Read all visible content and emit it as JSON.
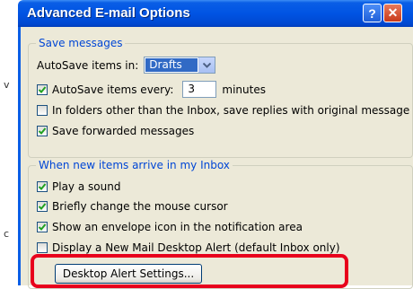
{
  "dialog": {
    "title": "Advanced E-mail Options",
    "help_glyph": "?",
    "close_glyph": "✕"
  },
  "left_edge": [
    "v",
    "c"
  ],
  "save_group": {
    "legend": "Save messages",
    "autosave_in_label": "AutoSave items in:",
    "autosave_in_value": "Drafts",
    "autosave_every": {
      "label": "AutoSave items every:",
      "value": "3",
      "unit": "minutes",
      "checked": true
    },
    "reply_other_folders": {
      "label": "In folders other than the Inbox, save replies with original message",
      "checked": false
    },
    "save_forwarded": {
      "label": "Save forwarded messages",
      "checked": true
    }
  },
  "arrive_group": {
    "legend": "When new items arrive in my Inbox",
    "play_sound": {
      "label": "Play a sound",
      "checked": true
    },
    "change_cursor": {
      "label": "Briefly change the mouse cursor",
      "checked": true
    },
    "envelope_icon": {
      "label": "Show an envelope icon in the notification area",
      "checked": true
    },
    "desktop_alert": {
      "label": "Display a New Mail Desktop Alert (default Inbox only)",
      "checked": false
    },
    "settings_button": "Desktop Alert Settings..."
  },
  "colors": {
    "title_bar": "#0054e3",
    "legend_text": "#0046d5",
    "highlight": "#e8001c",
    "dialog_bg": "#ece9d8"
  }
}
